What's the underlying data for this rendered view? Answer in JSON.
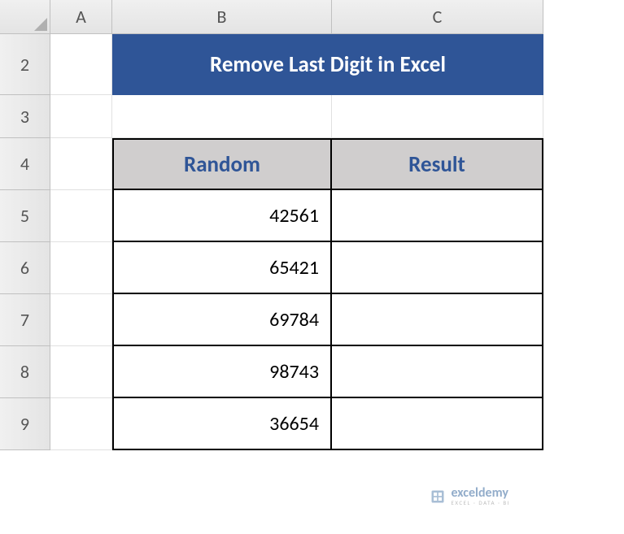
{
  "columns": {
    "A": "A",
    "B": "B",
    "C": "C"
  },
  "rows": {
    "r2": "2",
    "r3": "3",
    "r4": "4",
    "r5": "5",
    "r6": "6",
    "r7": "7",
    "r8": "8",
    "r9": "9"
  },
  "title": "Remove Last Digit in Excel",
  "headers": {
    "random": "Random",
    "result": "Result"
  },
  "data": {
    "r5": {
      "random": "42561",
      "result": ""
    },
    "r6": {
      "random": "65421",
      "result": ""
    },
    "r7": {
      "random": "69784",
      "result": ""
    },
    "r8": {
      "random": "98743",
      "result": ""
    },
    "r9": {
      "random": "36654",
      "result": ""
    }
  },
  "watermark": {
    "title": "exceldemy",
    "sub": "EXCEL · DATA · BI"
  },
  "chart_data": {
    "type": "table",
    "title": "Remove Last Digit in Excel",
    "columns": [
      "Random",
      "Result"
    ],
    "rows": [
      [
        42561,
        null
      ],
      [
        65421,
        null
      ],
      [
        69784,
        null
      ],
      [
        98743,
        null
      ],
      [
        36654,
        null
      ]
    ]
  }
}
